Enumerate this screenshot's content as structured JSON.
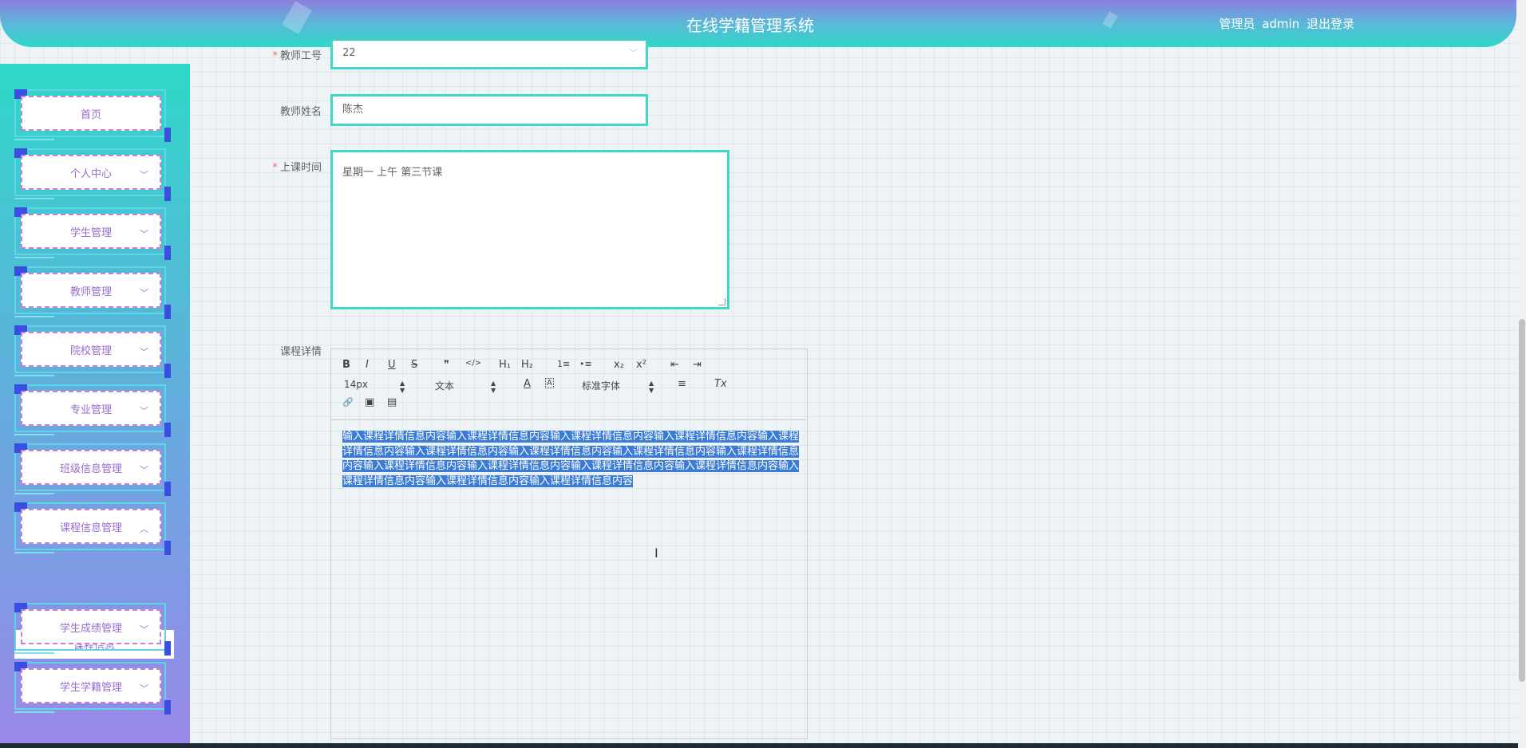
{
  "header": {
    "title": "在线学籍管理系统",
    "role": "管理员",
    "username": "admin",
    "logout": "退出登录"
  },
  "sidebar": {
    "items": [
      {
        "label": "首页",
        "chevron": ""
      },
      {
        "label": "个人中心",
        "chevron": "﹀"
      },
      {
        "label": "学生管理",
        "chevron": "﹀"
      },
      {
        "label": "教师管理",
        "chevron": "﹀"
      },
      {
        "label": "院校管理",
        "chevron": "﹀"
      },
      {
        "label": "专业管理",
        "chevron": "﹀"
      },
      {
        "label": "班级信息管理",
        "chevron": "﹀"
      },
      {
        "label": "课程信息管理",
        "chevron": "︿"
      },
      {
        "label": "学生成绩管理",
        "chevron": "﹀"
      },
      {
        "label": "学生学籍管理",
        "chevron": "﹀"
      }
    ],
    "submenu": {
      "label": "课程信息"
    }
  },
  "form": {
    "teacher_id": {
      "label": "教师工号",
      "required": "*",
      "value": "22",
      "chevron": "﹀"
    },
    "teacher_name": {
      "label": "教师姓名",
      "value": "陈杰"
    },
    "class_time": {
      "label": "上课时间",
      "required": "*",
      "value": "星期一  上午  第三节课"
    },
    "course_detail": {
      "label": "课程详情"
    }
  },
  "editor": {
    "toolbar": {
      "bold": "B",
      "italic": "I",
      "underline": "U",
      "strike": "S",
      "blockquote": "❞",
      "code": "</>",
      "h1": "H₁",
      "h2": "H₂",
      "ordered_list": "1≡",
      "bullet_list": "•≡",
      "subscript": "x₂",
      "superscript": "x²",
      "indent_decrease": "⇤",
      "indent_increase": "⇥",
      "size": "14px",
      "header_select": "文本",
      "font": "标准字体",
      "font_color": "A",
      "background_color": "A",
      "align": "≡",
      "clean": "Tx",
      "link": "🔗",
      "image": "▣",
      "video": "▤"
    },
    "content": "输入课程详情信息内容输入课程详情信息内容输入课程详情信息内容输入课程详情信息内容输入课程详情信息内容输入课程详情信息内容输入课程详情信息内容输入课程详情信息内容输入课程详情信息内容输入课程详情信息内容输入课程详情信息内容输入课程详情信息内容输入课程详情信息内容输入课程详情信息内容输入课程详情信息内容输入课程详情信息内容"
  },
  "colors": {
    "accent": "#3ed8c8",
    "menu_text": "#9a6bd0",
    "selection": "#3a7bd5"
  }
}
